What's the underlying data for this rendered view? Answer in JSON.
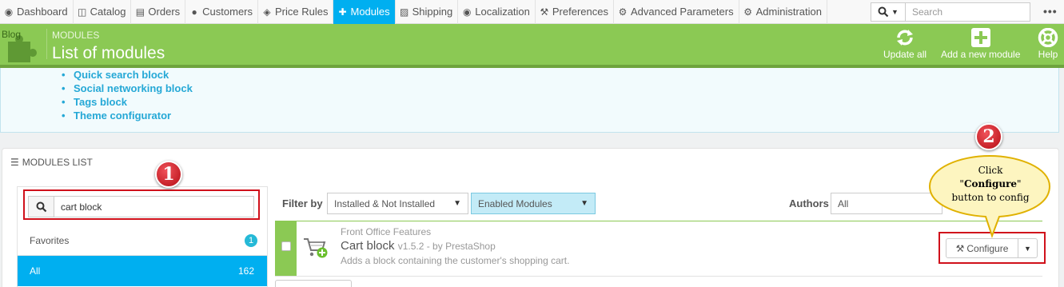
{
  "nav": {
    "items": [
      {
        "label": "Dashboard",
        "icon": "dashboard-icon"
      },
      {
        "label": "Catalog",
        "icon": "book-icon"
      },
      {
        "label": "Orders",
        "icon": "credit-card-icon"
      },
      {
        "label": "Customers",
        "icon": "users-icon"
      },
      {
        "label": "Price Rules",
        "icon": "tags-icon"
      },
      {
        "label": "Modules",
        "icon": "puzzle-icon",
        "active": true
      },
      {
        "label": "Shipping",
        "icon": "truck-icon"
      },
      {
        "label": "Localization",
        "icon": "globe-icon"
      },
      {
        "label": "Preferences",
        "icon": "wrench-icon"
      },
      {
        "label": "Advanced Parameters",
        "icon": "cogs-icon"
      },
      {
        "label": "Administration",
        "icon": "gear-icon"
      }
    ],
    "search_placeholder": "Search",
    "more": "•••"
  },
  "header": {
    "blog_label": "Blog",
    "breadcrumb": "MODULES",
    "title": "List of modules",
    "actions": {
      "update_all": "Update all",
      "add_new": "Add a new module",
      "help": "Help"
    }
  },
  "info_list": [
    "Quick search block",
    "Social networking block",
    "Tags block",
    "Theme configurator"
  ],
  "modules_panel": {
    "heading": "MODULES LIST",
    "search_value": "cart block",
    "categories": [
      {
        "label": "Favorites",
        "count": "1"
      },
      {
        "label": "All",
        "count": "162"
      }
    ],
    "filter_label": "Filter by",
    "filter_install": "Installed & Not Installed",
    "filter_status": "Enabled Modules",
    "authors_label": "Authors",
    "authors_value": "All"
  },
  "module": {
    "category": "Front Office Features",
    "name": "Cart block",
    "version_author": "v1.5.2 - by PrestaShop",
    "description": "Adds a block containing the customer's shopping cart.",
    "configure_label": "Configure"
  },
  "annotations": {
    "step1": "1",
    "step2": "2",
    "callout_line1": "Click",
    "callout_quote_open": "\"",
    "callout_bold": "Configure",
    "callout_quote_close": "\"",
    "callout_line3": "button to config",
    "colors": {
      "frame": "#d0111b",
      "callout_fill": "#fdf5c0",
      "callout_border": "#e0b100"
    }
  },
  "colors": {
    "accent": "#00aff0",
    "header_green": "#8bc954",
    "link_blue": "#25a8d6"
  }
}
